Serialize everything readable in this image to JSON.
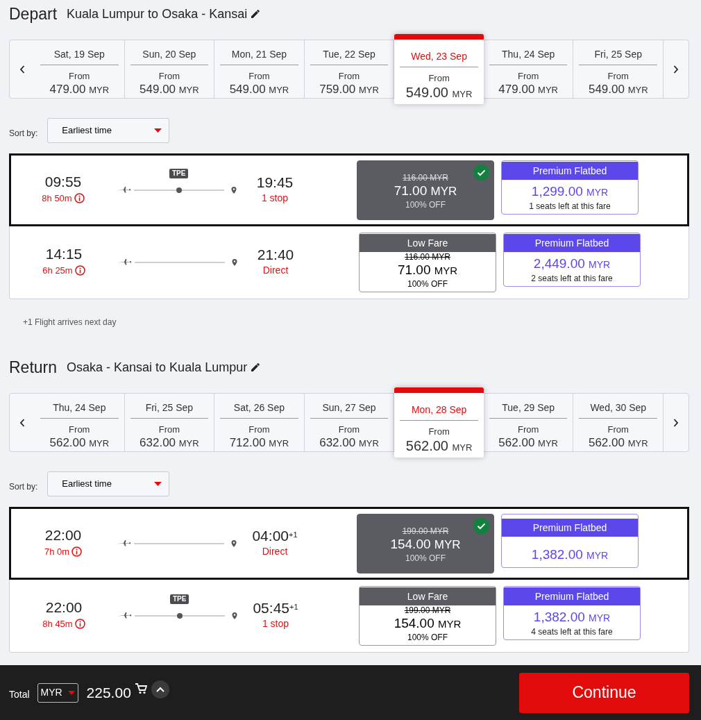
{
  "sections": [
    {
      "title": "Depart",
      "route": "Kuala Lumpur to Osaka - Kansai",
      "dates": [
        {
          "day": "Sat, 19 Sep",
          "from": "From",
          "price": "479.00",
          "currency": "MYR",
          "selected": false
        },
        {
          "day": "Sun, 20 Sep",
          "from": "From",
          "price": "549.00",
          "currency": "MYR",
          "selected": false
        },
        {
          "day": "Mon, 21 Sep",
          "from": "From",
          "price": "549.00",
          "currency": "MYR",
          "selected": false
        },
        {
          "day": "Tue, 22 Sep",
          "from": "From",
          "price": "759.00",
          "currency": "MYR",
          "selected": false
        },
        {
          "day": "Wed, 23 Sep",
          "from": "From",
          "price": "549.00",
          "currency": "MYR",
          "selected": true
        },
        {
          "day": "Thu, 24 Sep",
          "from": "From",
          "price": "479.00",
          "currency": "MYR",
          "selected": false
        },
        {
          "day": "Fri, 25 Sep",
          "from": "From",
          "price": "549.00",
          "currency": "MYR",
          "selected": false
        }
      ],
      "sort": {
        "label": "Sort by:",
        "value": "Earliest time"
      },
      "flights": [
        {
          "depart": "09:55",
          "duration": "8h 50m",
          "via": "TPE",
          "arrive": "19:45",
          "stops": "1 stop",
          "selected": true,
          "fares": [
            {
              "kind": "low",
              "old_price": "116.00 MYR",
              "price": "71.00",
              "currency": "MYR",
              "discount": "100% OFF",
              "selected": true
            },
            {
              "kind": "premium",
              "header": "Premium Flatbed",
              "price": "1,299.00",
              "currency": "MYR",
              "seats": "1 seats left at this fare"
            }
          ]
        },
        {
          "depart": "14:15",
          "duration": "6h 25m",
          "arrive": "21:40",
          "stops": "Direct",
          "selected": false,
          "fares": [
            {
              "kind": "low",
              "header": "Low Fare",
              "old_price": "116.00 MYR",
              "price": "71.00",
              "currency": "MYR",
              "discount": "100% OFF",
              "selected": false
            },
            {
              "kind": "premium",
              "header": "Premium Flatbed",
              "price": "2,449.00",
              "currency": "MYR",
              "seats": "2 seats left at this fare"
            }
          ]
        }
      ],
      "note": "+1 Flight arrives next day"
    },
    {
      "title": "Return",
      "route": "Osaka - Kansai to Kuala Lumpur",
      "dates": [
        {
          "day": "Thu, 24 Sep",
          "from": "From",
          "price": "562.00",
          "currency": "MYR",
          "selected": false
        },
        {
          "day": "Fri, 25 Sep",
          "from": "From",
          "price": "632.00",
          "currency": "MYR",
          "selected": false
        },
        {
          "day": "Sat, 26 Sep",
          "from": "From",
          "price": "712.00",
          "currency": "MYR",
          "selected": false
        },
        {
          "day": "Sun, 27 Sep",
          "from": "From",
          "price": "632.00",
          "currency": "MYR",
          "selected": false
        },
        {
          "day": "Mon, 28 Sep",
          "from": "From",
          "price": "562.00",
          "currency": "MYR",
          "selected": true
        },
        {
          "day": "Tue, 29 Sep",
          "from": "From",
          "price": "562.00",
          "currency": "MYR",
          "selected": false
        },
        {
          "day": "Wed, 30 Sep",
          "from": "From",
          "price": "562.00",
          "currency": "MYR",
          "selected": false
        }
      ],
      "sort": {
        "label": "Sort by:",
        "value": "Earliest time"
      },
      "flights": [
        {
          "depart": "22:00",
          "duration": "7h 0m",
          "arrive": "04:00",
          "arrive_suffix": "+1",
          "stops": "Direct",
          "selected": true,
          "fares": [
            {
              "kind": "low",
              "old_price": "199.00 MYR",
              "price": "154.00",
              "currency": "MYR",
              "discount": "100% OFF",
              "selected": true
            },
            {
              "kind": "premium",
              "header": "Premium Flatbed",
              "price": "1,382.00",
              "currency": "MYR"
            }
          ]
        },
        {
          "depart": "22:00",
          "duration": "8h 45m",
          "via": "TPE",
          "arrive": "05:45",
          "arrive_suffix": "+1",
          "stops": "1 stop",
          "selected": false,
          "fares": [
            {
              "kind": "low",
              "header": "Low Fare",
              "old_price": "199.00 MYR",
              "price": "154.00",
              "currency": "MYR",
              "discount": "100% OFF",
              "selected": false
            },
            {
              "kind": "premium",
              "header": "Premium Flatbed",
              "price": "1,382.00",
              "currency": "MYR",
              "seats": "4 seats left at this fare"
            }
          ]
        }
      ]
    }
  ],
  "footer": {
    "label": "Total",
    "currency": "MYR",
    "total": "225.00",
    "button": "Continue"
  }
}
